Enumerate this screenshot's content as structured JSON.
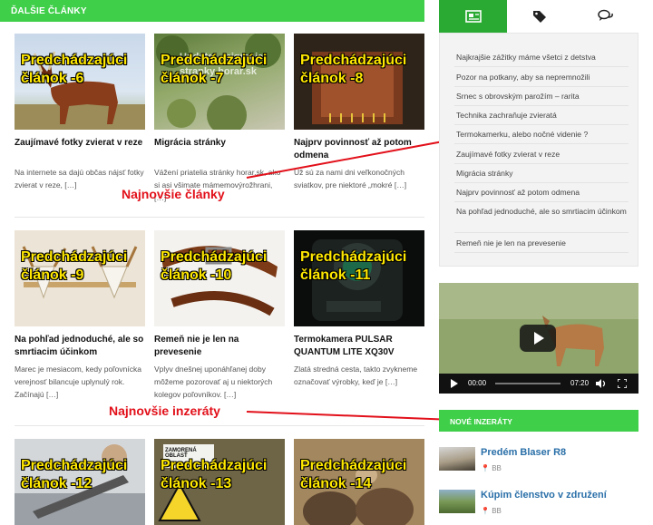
{
  "section_title": "ĎALŠIE ČLÁNKY",
  "articles": [
    {
      "overlay": "Predchádzajúci\nčlánok -6",
      "title": "Zaujímavé fotky zvierat v reze",
      "excerpt": "Na internete sa dajú občas nájsť fotky zvierat v reze, […]"
    },
    {
      "overlay": "Predchádzajúci\nčlánok -7",
      "title": "Migrácia stránky",
      "excerpt": "Vážení priatelia stránky horar.sk, ako si asi všimate mámemovýrožhrani, […]"
    },
    {
      "overlay": "Predchádzajúci\nčlánok -8",
      "title": "Najprv povinnosť až potom odmena",
      "excerpt": "Už sú za nami dni veľkonočných sviatkov, pre niektoré „mokré […]"
    },
    {
      "overlay": "Predchádzajúci\nčlánok -9",
      "title": "Na pohľad jednoduché, ale so smrtiacim účinkom",
      "excerpt": "Marec je mesiacom, kedy poľovnícka verejnosť bilancuje uplynulý rok. Začínajú […]"
    },
    {
      "overlay": "Predchádzajúci\nčlánok -10",
      "title": "Remeň nie je len na prevesenie",
      "excerpt": "Vplyv dnešnej uponáhľanej doby môžeme pozorovať aj u niektorých kolegov poľovníkov. […]"
    },
    {
      "overlay": "Predchádzajúci\nčlánok -11",
      "title": "Termokamera PULSAR QUANTUM LITE XQ30V",
      "excerpt": "Zlatá stredná cesta, takto zvykneme označovať výrobky, keď je […]"
    },
    {
      "overlay": "Predchádzajúci\nčlánok -12",
      "title": "",
      "excerpt": ""
    },
    {
      "overlay": "Predchádzajúci\nčlánok -13",
      "title": "",
      "excerpt": ""
    },
    {
      "overlay": "Predchádzajúci\nčlánok -14",
      "title": "",
      "excerpt": ""
    }
  ],
  "image_texts": {
    "migracia": "Update - migracia\nstranky horar.sk",
    "sign": "ZAMORENÁ OBLASŤ"
  },
  "annotations": {
    "latest_articles": "Najnovšie články",
    "latest_ads": "Najnovšie inzeráty"
  },
  "tabs": [
    {
      "icon": "newspaper-icon"
    },
    {
      "icon": "tags-icon"
    },
    {
      "icon": "comments-icon"
    }
  ],
  "latest_list": [
    "Najkrajšie zážitky máme všetci z detstva",
    "Pozor na potkany, aby sa nepremnožili",
    "Srnec s obrovským parožím – rarita",
    "Technika zachraňuje zvieratá",
    "Termokamerku, alebo nočné videnie ?",
    "Zaujímavé fotky zvierat v reze",
    "Migrácia stránky",
    "Najprv povinnosť až potom odmena",
    "Na pohľad jednoduché, ale so smrtiacim účinkom",
    "Remeň nie je len na prevesenie"
  ],
  "video": {
    "current": "00:00",
    "duration": "07:20",
    "progress": 0
  },
  "ads_title": "NOVÉ INZERÁTY",
  "ads": [
    {
      "title": "Predém Blaser R8",
      "location": "BB"
    },
    {
      "title": "Kúpim členstvo v združení",
      "location": "BB"
    }
  ],
  "colors": {
    "accent": "#3fcf49",
    "accent_dark": "#2aaa33",
    "overlay_text": "#ffe800",
    "annotation": "#e2101a",
    "ad_link": "#2a6fa8"
  }
}
